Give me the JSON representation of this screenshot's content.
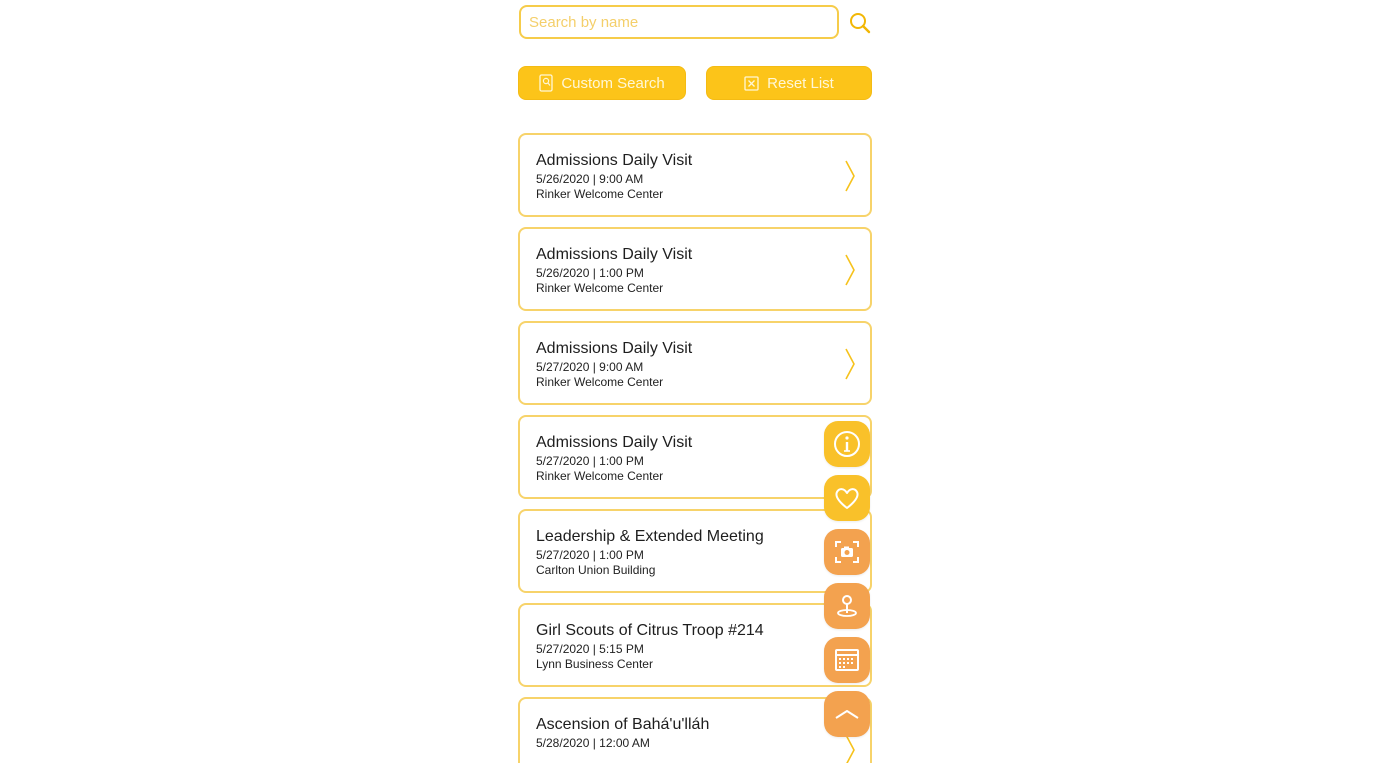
{
  "search": {
    "placeholder": "Search by name",
    "value": ""
  },
  "actions": {
    "custom_search_label": "Custom Search",
    "reset_list_label": "Reset List"
  },
  "events": [
    {
      "title": "Admissions Daily Visit",
      "datetime": "5/26/2020 | 9:00 AM",
      "location": "Rinker Welcome Center"
    },
    {
      "title": "Admissions Daily Visit",
      "datetime": "5/26/2020 | 1:00 PM",
      "location": "Rinker Welcome Center"
    },
    {
      "title": "Admissions Daily Visit",
      "datetime": "5/27/2020 | 9:00 AM",
      "location": "Rinker Welcome Center"
    },
    {
      "title": "Admissions Daily Visit",
      "datetime": "5/27/2020 | 1:00 PM",
      "location": "Rinker Welcome Center"
    },
    {
      "title": "Leadership & Extended Meeting",
      "datetime": "5/27/2020 | 1:00 PM",
      "location": "Carlton Union Building"
    },
    {
      "title": "Girl Scouts of Citrus Troop #214",
      "datetime": "5/27/2020 | 5:15 PM",
      "location": "Lynn Business Center"
    },
    {
      "title": "Ascension of Bahá'u'lláh",
      "datetime": "5/28/2020 | 12:00 AM",
      "location": ""
    }
  ],
  "floating_menu": [
    {
      "icon": "info-icon",
      "color": "#f9c12a"
    },
    {
      "icon": "heart-icon",
      "color": "#f9c12a"
    },
    {
      "icon": "camera-scan-icon",
      "color": "#f3a24f"
    },
    {
      "icon": "map-pin-icon",
      "color": "#f3a24f"
    },
    {
      "icon": "calendar-icon",
      "color": "#f3a24f"
    },
    {
      "icon": "chevron-up-icon",
      "color": "#f3a24f"
    }
  ],
  "colors": {
    "accent": "#fcc419",
    "card_border": "#f7d36a",
    "fab_orange": "#f3a24f"
  }
}
